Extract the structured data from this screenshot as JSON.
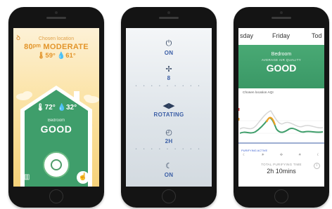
{
  "colors": {
    "amber": "#e3952b",
    "green": "#3f9e6b",
    "blue": "#3b5ea6"
  },
  "phone1": {
    "location_label": "Chosen location",
    "outdoor_quality": "80ᵖᵐ MODERATE",
    "range": "🌡59° 💧61°",
    "indoor_temps": "🌡72° 💧32°",
    "room": "Bedroom",
    "status": "GOOD",
    "icons": [
      "dyson-logo-icon",
      "chart-icon",
      "hand-remote-icon",
      "fan-icon"
    ]
  },
  "phone2": {
    "controls": [
      {
        "icon": "power-icon",
        "label": "ON"
      },
      {
        "icon": "fan-speed-icon",
        "label": "8"
      },
      {
        "icon": "oscillation-icon",
        "label": "ROTATING"
      },
      {
        "icon": "timer-icon",
        "label": "2H"
      },
      {
        "icon": "moon-icon",
        "label": "ON"
      }
    ]
  },
  "phone3": {
    "days": [
      "sday",
      "Friday",
      "Tod"
    ],
    "room": "Bedroom",
    "aq_label": "AVERAGE AIR QUALITY",
    "status": "GOOD",
    "chart_title": "Chosen location AQI",
    "legend": "PURIFYING ACTIVE",
    "total_label": "TOTAL PURIFYING TIME",
    "total_value": "2h 10mins"
  }
}
